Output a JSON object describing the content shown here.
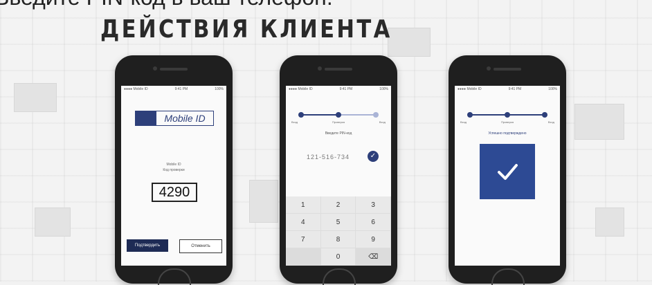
{
  "caption": "Введите PIN-код в ваш телефон.",
  "heading": "ДЕЙСТВИЯ КЛИЕНТА",
  "colors": {
    "brand": "#2d3f7a",
    "check_box": "#2d4a94",
    "confirm_button": "#1e2b55"
  },
  "phone1": {
    "status_left": "●●●● Mobile ID ",
    "status_time": "9:41 PM",
    "status_right": "100%",
    "logo_text": "Mobile ID",
    "line1": "Mobile ID",
    "line2": "Код проверки",
    "code": "4290",
    "confirm_label": "Подтвердить",
    "reject_label": "Отменить"
  },
  "phone2": {
    "status_left": "●●●● Mobile ID ",
    "status_time": "9:41 PM",
    "status_right": "100%",
    "steps": [
      "Вход",
      "Проверка",
      "Вход"
    ],
    "pin_label": "Введите PIN-код",
    "pin_value": "121-516-734",
    "check_icon": "check-icon",
    "keys": [
      "1",
      "2",
      "3",
      "4",
      "5",
      "6",
      "7",
      "8",
      "9",
      "",
      "0",
      "⌫"
    ]
  },
  "phone3": {
    "status_left": "●●●● Mobile ID ",
    "status_time": "9:41 PM",
    "status_right": "100%",
    "steps": [
      "Вход",
      "Проверка",
      "Вход"
    ],
    "done_label": "Успешно подтверждено",
    "check_icon": "check-icon"
  }
}
